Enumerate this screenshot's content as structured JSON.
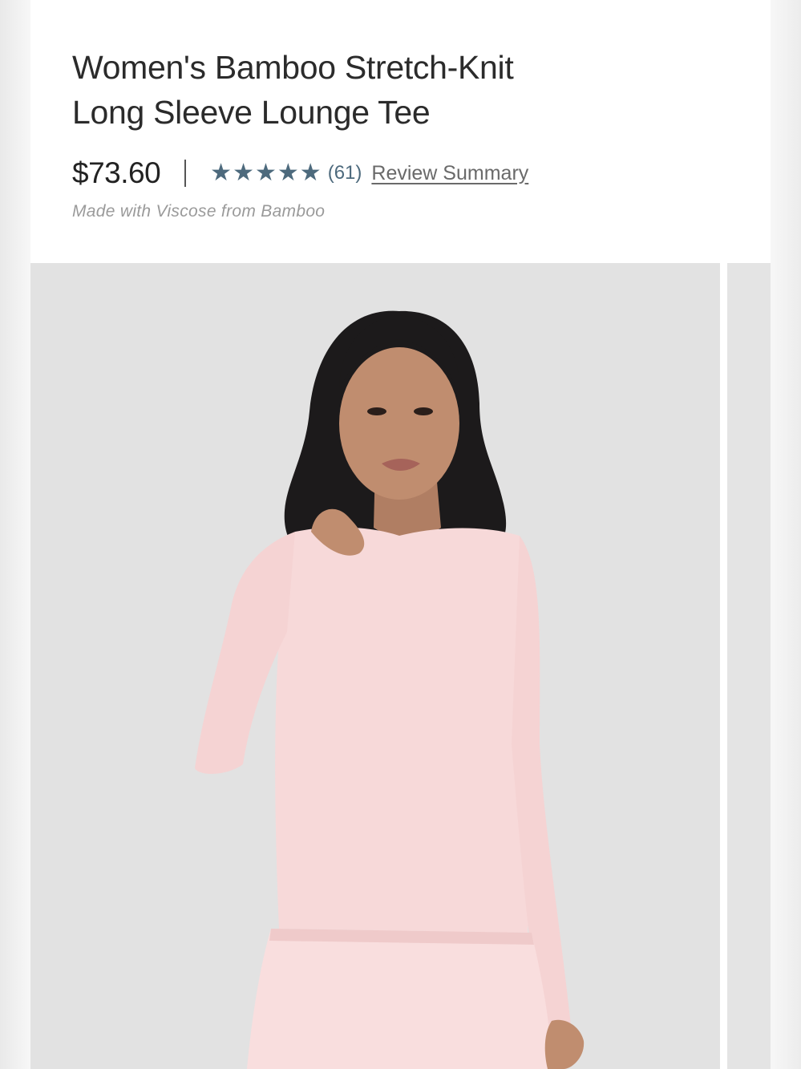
{
  "product": {
    "title": "Women's Bamboo Stretch-Knit Long Sleeve Lounge Tee",
    "price": "$73.60",
    "rating_stars": 5,
    "review_count": "(61)",
    "review_link": "Review Summary",
    "material_note": "Made with Viscose from Bamboo"
  },
  "gallery": {
    "main_image_icon": "product-photo-model-pink-tee",
    "next_image_icon": "product-photo-peek"
  },
  "colors": {
    "star": "#4d6a7d",
    "image_bg": "#e2e2e2",
    "tee": "#f7d9d9"
  }
}
